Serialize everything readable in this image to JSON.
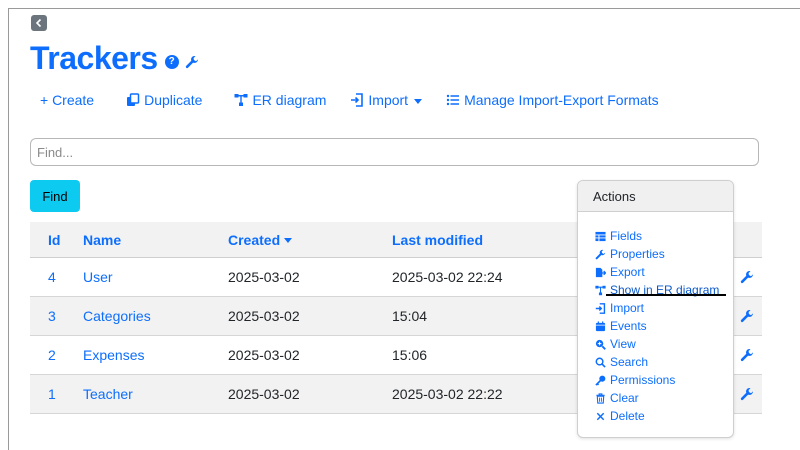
{
  "header": {
    "title": "Trackers",
    "help_glyph": "?"
  },
  "toolbar": {
    "create_label": "+ Create",
    "duplicate_label": "Duplicate",
    "er_label": "ER diagram",
    "import_label": "Import",
    "manage_label": "Manage Import-Export Formats"
  },
  "search": {
    "placeholder": "Find...",
    "value": ""
  },
  "find_button": "Find",
  "table": {
    "headers": {
      "id": "Id",
      "name": "Name",
      "created": "Created",
      "modified": "Last modified"
    },
    "rows": [
      {
        "id": "4",
        "name": "User",
        "created": "2025-03-02",
        "modified": "2025-03-02 22:24"
      },
      {
        "id": "3",
        "name": "Categories",
        "created": "2025-03-02",
        "modified": "15:04"
      },
      {
        "id": "2",
        "name": "Expenses",
        "created": "2025-03-02",
        "modified": "15:06"
      },
      {
        "id": "1",
        "name": "Teacher",
        "created": "2025-03-02",
        "modified": "2025-03-02 22:22"
      }
    ]
  },
  "actions": {
    "title": "Actions",
    "items": [
      {
        "label": "Fields",
        "icon": "table-icon"
      },
      {
        "label": "Properties",
        "icon": "wrench-icon"
      },
      {
        "label": "Export",
        "icon": "export-icon"
      },
      {
        "label": "Show in ER diagram",
        "icon": "diagram-icon",
        "hovered": true
      },
      {
        "label": "Import",
        "icon": "import-icon"
      },
      {
        "label": "Events",
        "icon": "calendar-icon"
      },
      {
        "label": "View",
        "icon": "zoom-icon"
      },
      {
        "label": "Search",
        "icon": "search-icon"
      },
      {
        "label": "Permissions",
        "icon": "key-icon"
      },
      {
        "label": "Clear",
        "icon": "trash-icon"
      },
      {
        "label": "Delete",
        "icon": "close-icon"
      }
    ]
  },
  "colors": {
    "primary": "#0d6efd",
    "find_button": "#0dcaf0",
    "row_stripe": "#f2f2f2"
  }
}
